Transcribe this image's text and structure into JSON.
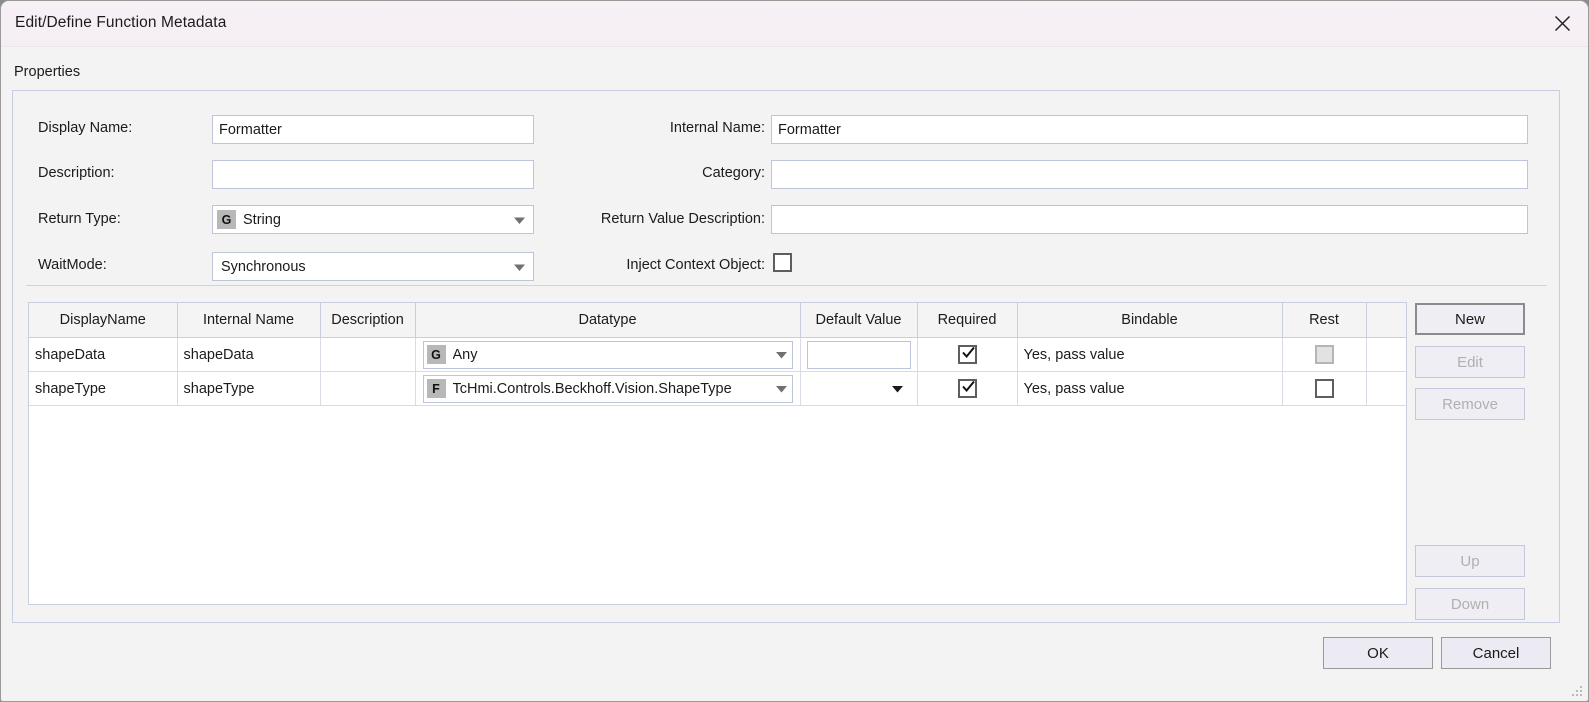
{
  "window": {
    "title": "Edit/Define Function Metadata",
    "close_icon": "close-icon",
    "resize_grip_icon": "resize-grip-icon"
  },
  "properties": {
    "section_label": "Properties",
    "fields": {
      "display_name": {
        "label": "Display Name:",
        "value": "Formatter",
        "placeholder": ""
      },
      "internal_name": {
        "label": "Internal Name:",
        "value": "Formatter",
        "placeholder": ""
      },
      "description": {
        "label": "Description:",
        "value": "",
        "placeholder": ""
      },
      "category": {
        "label": "Category:",
        "value": "",
        "placeholder": ""
      },
      "return_type": {
        "label": "Return Type:",
        "value": "String",
        "badge": "G",
        "caret_icon": "chevron-down-icon"
      },
      "return_value_description": {
        "label": "Return Value Description:",
        "value": "",
        "placeholder": ""
      },
      "wait_mode": {
        "label": "WaitMode:",
        "value": "Synchronous",
        "caret_icon": "chevron-down-icon"
      },
      "inject_context_object": {
        "label": "Inject Context Object:",
        "checked": false
      }
    }
  },
  "parameters_grid": {
    "columns": [
      "DisplayName",
      "Internal Name",
      "Description",
      "Datatype",
      "Default Value",
      "Required",
      "Bindable",
      "Rest"
    ],
    "rows": [
      {
        "display_name": "shapeData",
        "internal_name": "shapeData",
        "description": "",
        "datatype": {
          "badge": "G",
          "text": "Any",
          "caret_icon": "chevron-down-icon"
        },
        "default_value": {
          "kind": "textbox",
          "value": ""
        },
        "required": true,
        "bindable": "Yes, pass value",
        "rest": {
          "checked": false,
          "disabled": true
        }
      },
      {
        "display_name": "shapeType",
        "internal_name": "shapeType",
        "description": "",
        "datatype": {
          "badge": "F",
          "text": "TcHmi.Controls.Beckhoff.Vision.ShapeType",
          "caret_icon": "chevron-down-icon"
        },
        "default_value": {
          "kind": "combobox",
          "value": "",
          "caret_icon": "chevron-down-icon"
        },
        "required": true,
        "bindable": "Yes, pass value",
        "rest": {
          "checked": false,
          "disabled": false
        }
      }
    ]
  },
  "side_buttons": [
    {
      "label": "New",
      "state": "default"
    },
    {
      "label": "Edit",
      "state": "disabled"
    },
    {
      "label": "Remove",
      "state": "disabled"
    },
    {
      "label": "Up",
      "state": "disabled"
    },
    {
      "label": "Down",
      "state": "disabled"
    }
  ],
  "footer": {
    "ok_label": "OK",
    "cancel_label": "Cancel"
  },
  "colors": {
    "titlebar": "#f6f0f5",
    "dialog_bg": "#f3f3f3",
    "border": "#c9cde0",
    "badge_bg": "#b8b8b8",
    "button_bg": "#efeef5"
  }
}
